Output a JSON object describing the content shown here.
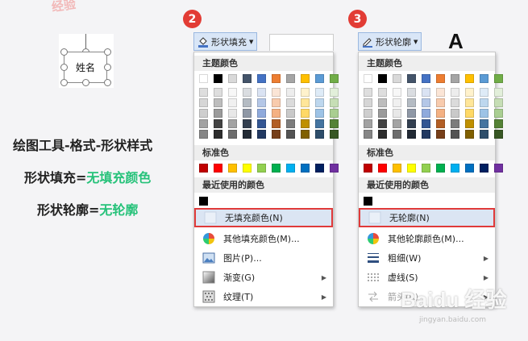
{
  "watermark_top": "经验",
  "shape": {
    "label": "姓名"
  },
  "captions": {
    "path": "绘图工具-格式-形状样式",
    "fill_prefix": "形状填充=",
    "fill_value": "无填充颜色",
    "outline_prefix": "形状轮廓=",
    "outline_value": "无轮廓"
  },
  "markers": [
    "2",
    "3"
  ],
  "fill_panel": {
    "button_label": "形状填充",
    "theme_header": "主题颜色",
    "standard_header": "标准色",
    "recent_header": "最近使用的颜色",
    "items": [
      {
        "label": "无填充颜色(N)",
        "icon": "none-square-icon",
        "highlighted": true
      },
      {
        "label": "其他填充颜色(M)...",
        "icon": "palette-icon"
      },
      {
        "label": "图片(P)...",
        "icon": "picture-icon"
      },
      {
        "label": "渐变(G)",
        "icon": "gradient-icon",
        "submenu": true
      },
      {
        "label": "纹理(T)",
        "icon": "texture-icon",
        "submenu": true
      }
    ]
  },
  "outline_panel": {
    "button_label": "形状轮廓",
    "big_letter": "A",
    "theme_header": "主题颜色",
    "standard_header": "标准色",
    "recent_header": "最近使用的颜色",
    "items": [
      {
        "label": "无轮廓(N)",
        "icon": "none-square-icon",
        "highlighted": true
      },
      {
        "label": "其他轮廓颜色(M)...",
        "icon": "palette-icon"
      },
      {
        "label": "粗细(W)",
        "icon": "line-weight-icon",
        "submenu": true
      },
      {
        "label": "虚线(S)",
        "icon": "dash-icon",
        "submenu": true
      },
      {
        "label": "箭头(R)",
        "icon": "arrow-line-icon",
        "submenu": true,
        "disabled": true
      }
    ]
  },
  "theme_colors": [
    "#ffffff",
    "#000000",
    "#eeece1",
    "#1f497d",
    "#4f81bd",
    "#c0504d",
    "#9bbb59",
    "#8064a2",
    "#4bacc6",
    "#f79646"
  ],
  "theme_top_row": [
    "#ffffff",
    "#000000",
    "#d9d9d9",
    "#44546a",
    "#4472c4",
    "#ed7d31",
    "#a5a5a5",
    "#ffc000",
    "#5b9bd5",
    "#70ad47"
  ],
  "standard_colors": [
    "#c00000",
    "#ff0000",
    "#ffc000",
    "#ffff00",
    "#92d050",
    "#00b050",
    "#00b0f0",
    "#0070c0",
    "#002060",
    "#7030a0"
  ],
  "recent_color": "#000000",
  "watermark_bottom": "Baidu 经验",
  "watermark_sub": "jingyan.baidu.com"
}
